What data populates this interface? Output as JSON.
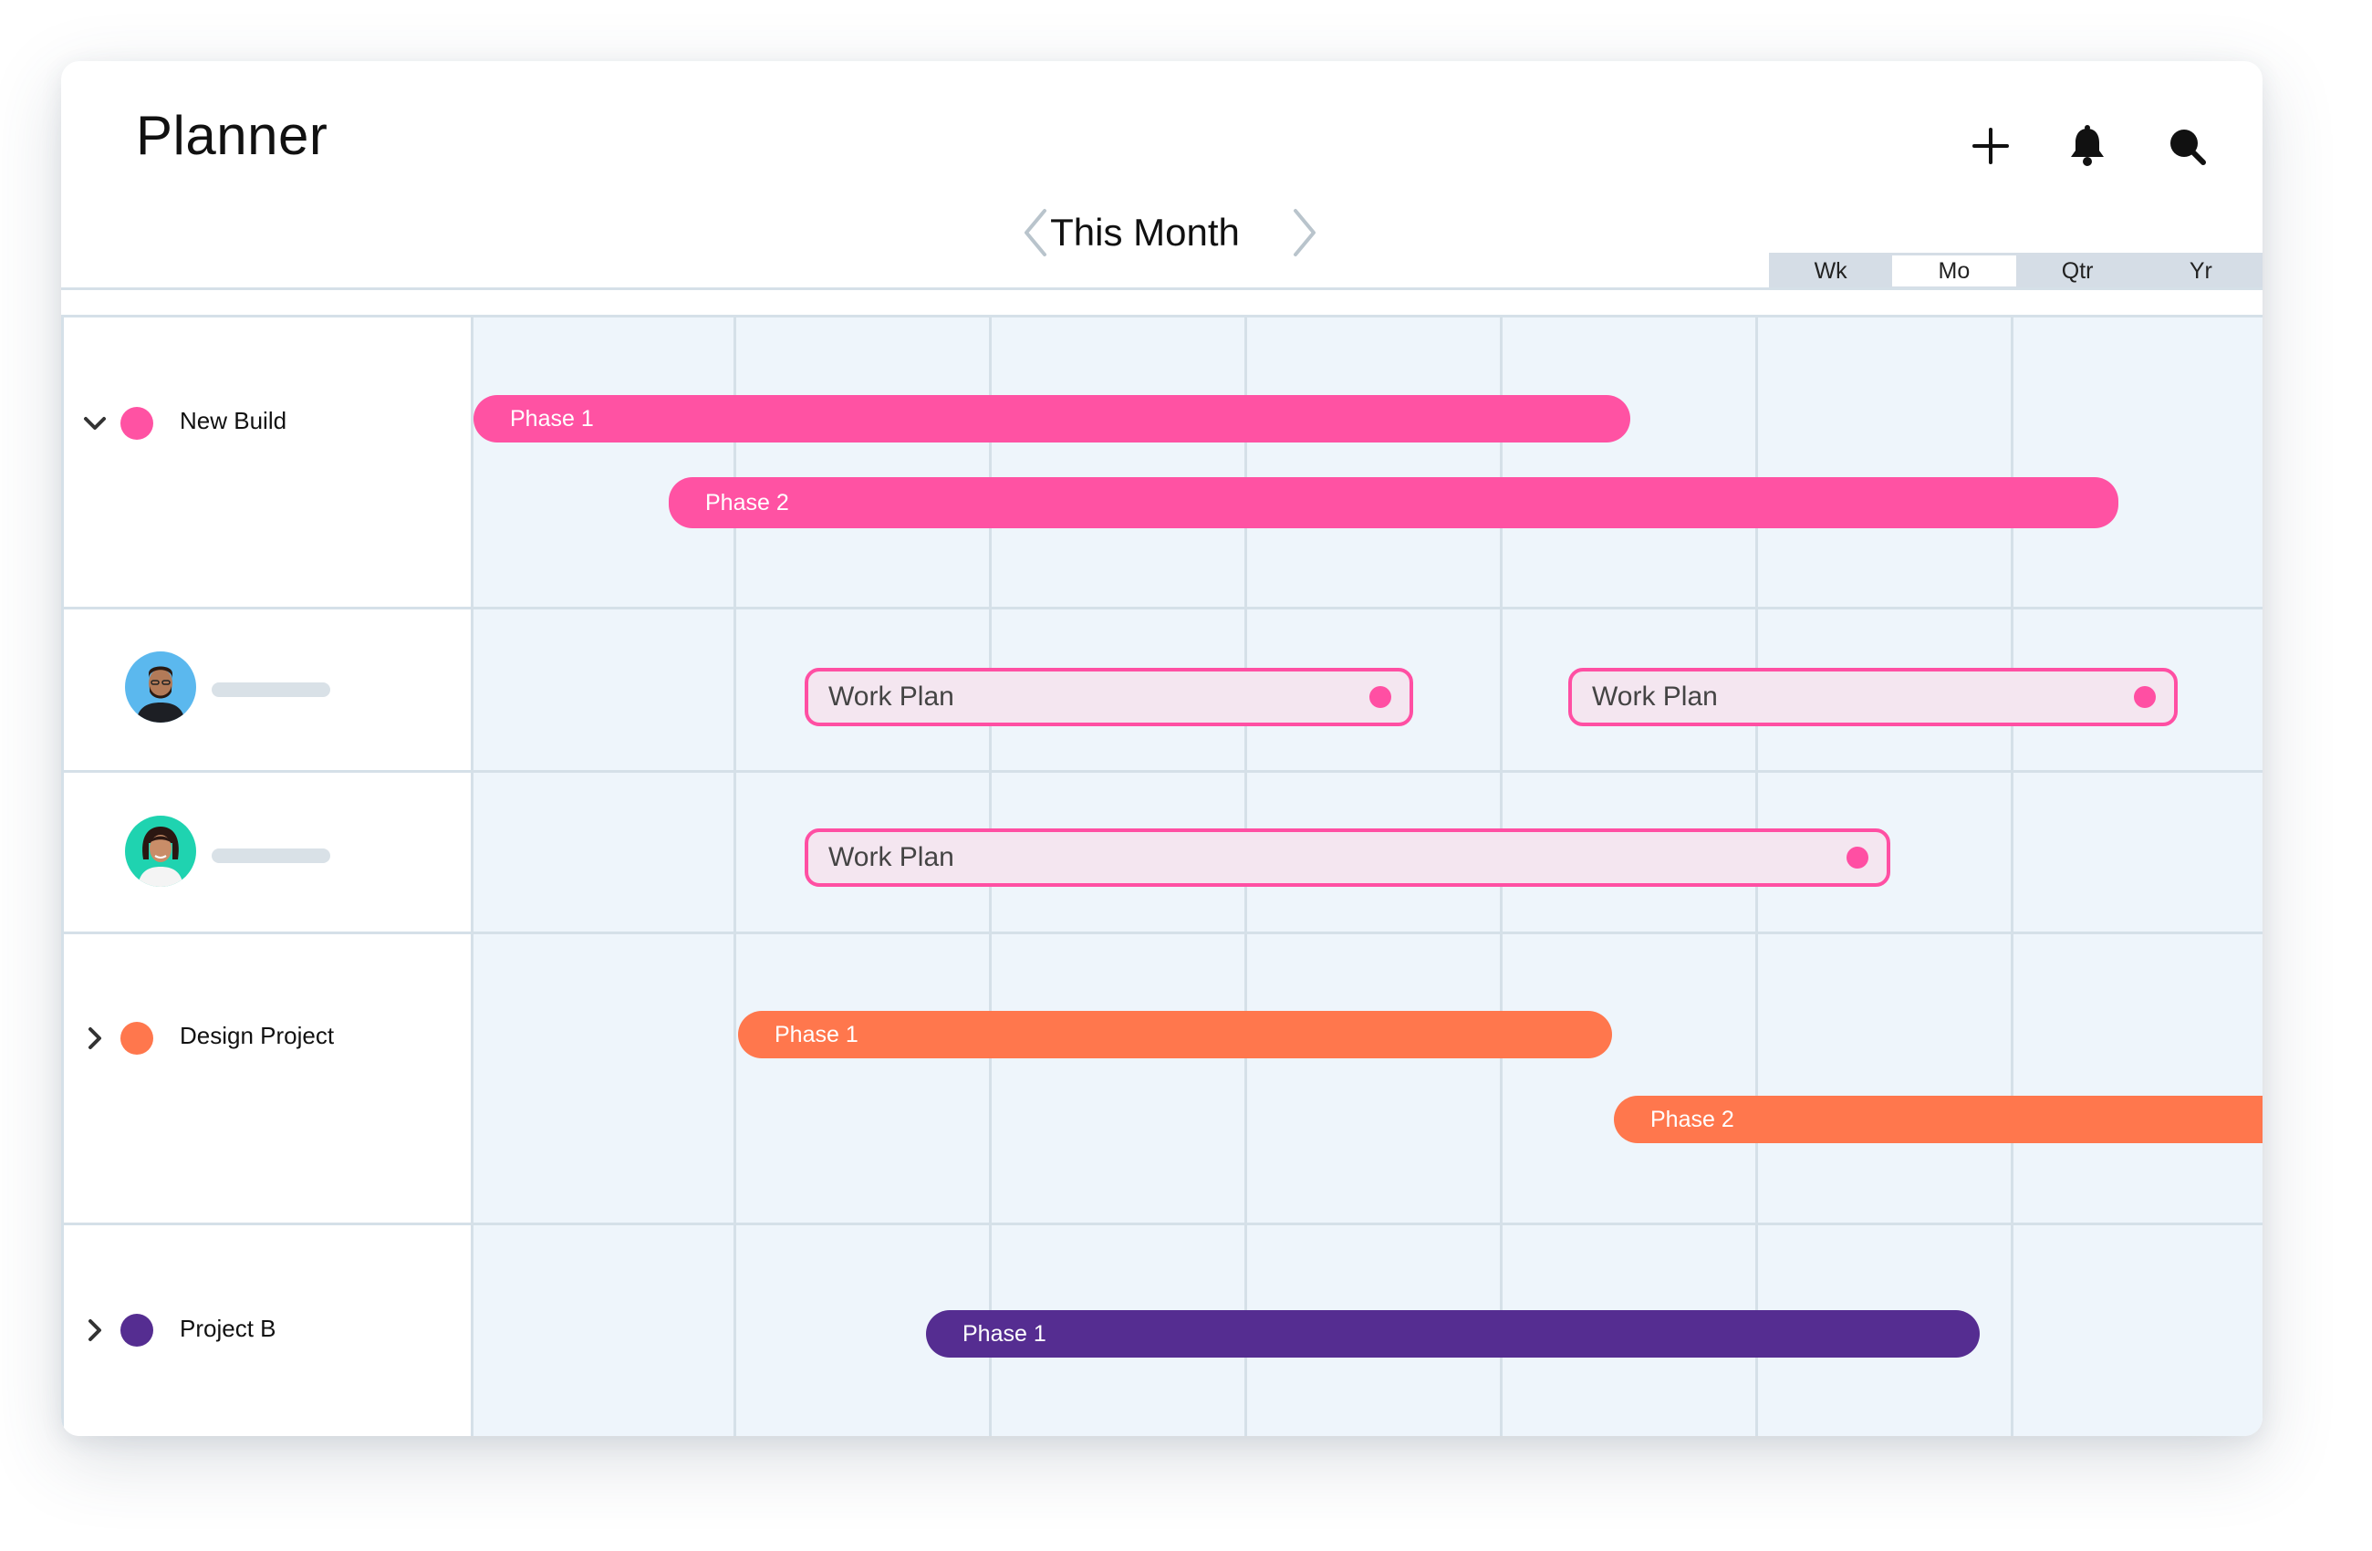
{
  "header": {
    "title": "Planner",
    "actions": [
      {
        "name": "add",
        "icon": "plus-icon"
      },
      {
        "name": "notifications",
        "icon": "bell-icon"
      },
      {
        "name": "search",
        "icon": "search-icon"
      }
    ]
  },
  "period": {
    "label": "This Month",
    "prev_icon": "chevron-left-icon",
    "next_icon": "chevron-right-icon"
  },
  "view_toggle": {
    "options": [
      "Wk",
      "Mo",
      "Qtr",
      "Yr"
    ],
    "selected": "Mo"
  },
  "colors": {
    "pink": "#ff52a3",
    "orange": "#ff774d",
    "purple": "#552d91",
    "work_border": "#ff4fa3",
    "work_fill": "#f4e6f0",
    "grid_line": "#d5e0e8",
    "timeline_bg": "#eef5fb"
  },
  "rows": [
    {
      "type": "project",
      "name": "New Build",
      "expanded": true,
      "color": "#ff52a3",
      "bars": [
        {
          "label": "Phase 1",
          "color": "#ff52a3"
        },
        {
          "label": "Phase 2",
          "color": "#ff52a3"
        }
      ]
    },
    {
      "type": "person",
      "avatar": "male-avatar",
      "work_items": [
        {
          "label": "Work Plan"
        },
        {
          "label": "Work Plan"
        }
      ]
    },
    {
      "type": "person",
      "avatar": "female-avatar",
      "work_items": [
        {
          "label": "Work Plan"
        }
      ]
    },
    {
      "type": "project",
      "name": "Design Project",
      "expanded": false,
      "color": "#ff774d",
      "bars": [
        {
          "label": "Phase 1",
          "color": "#ff774d"
        },
        {
          "label": "Phase  2",
          "color": "#ff774d"
        }
      ]
    },
    {
      "type": "project",
      "name": "Project B",
      "expanded": false,
      "color": "#552d91",
      "bars": [
        {
          "label": "Phase 1",
          "color": "#552d91"
        }
      ]
    }
  ]
}
